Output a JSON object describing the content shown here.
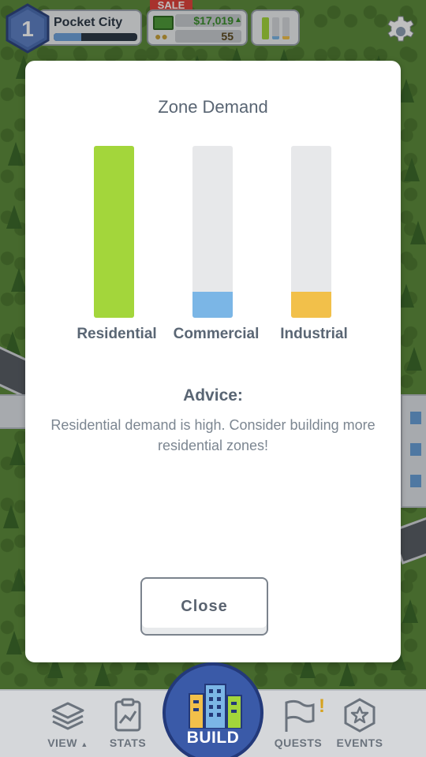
{
  "hud": {
    "level": "1",
    "city_name": "Pocket City",
    "xp_progress": 0.33,
    "sale_text": "SALE",
    "money": "$17,019",
    "population": "55",
    "icons": {
      "level": "hexagon-level-icon",
      "money": "cash-icon",
      "population": "people-icon",
      "rci": "rci-bars-icon",
      "settings": "gear-icon"
    }
  },
  "modal": {
    "title": "Zone Demand",
    "bars": [
      {
        "label": "Residential",
        "demand": 1.0,
        "color": "#a3d63b"
      },
      {
        "label": "Commercial",
        "demand": 0.15,
        "color": "#7bb6e6"
      },
      {
        "label": "Industrial",
        "demand": 0.15,
        "color": "#f2c04a"
      }
    ],
    "advice_title": "Advice:",
    "advice_text": "Residential demand is high. Consider building more residential zones!",
    "close_label": "Close"
  },
  "nav": {
    "view": "VIEW",
    "stats": "STATS",
    "build": "BUILD",
    "quests": "QUESTS",
    "events": "EVENTS"
  },
  "colors": {
    "residential": "#a3d63b",
    "commercial": "#7bb6e6",
    "industrial": "#f2c04a",
    "build_button": "#3a5aa8",
    "level_badge": "#4d6fb3"
  }
}
